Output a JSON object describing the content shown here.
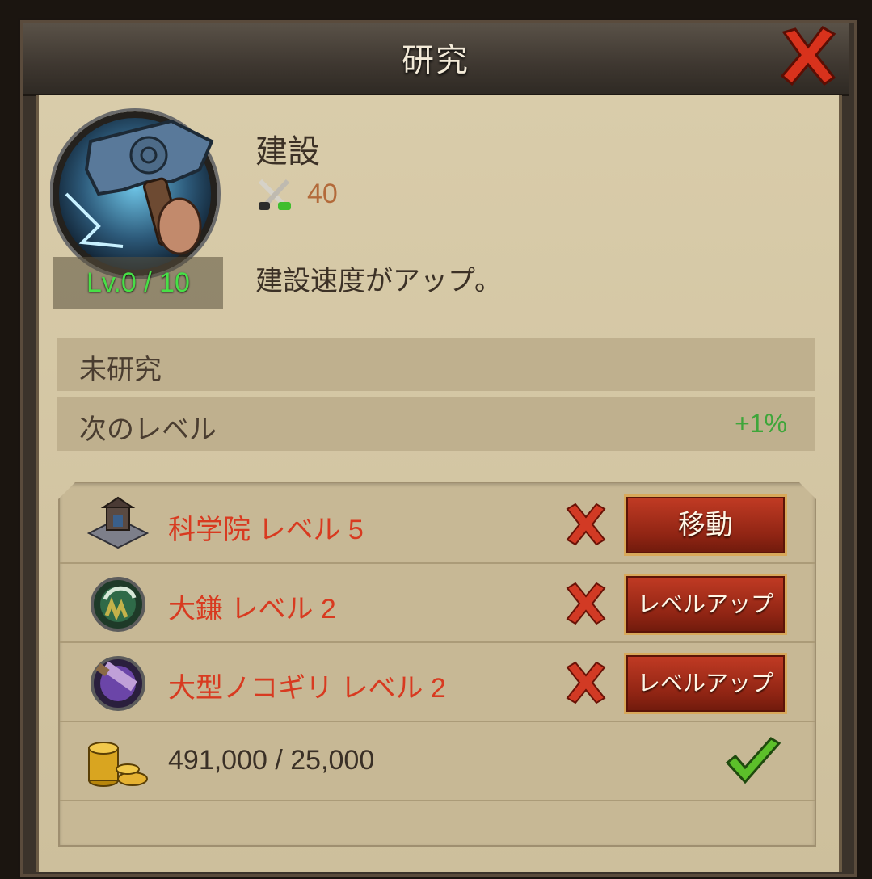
{
  "window": {
    "title": "研究"
  },
  "research": {
    "name": "建設",
    "level_label": "Lv.0 / 10",
    "power_value": "40",
    "description": "建設速度がアップ。",
    "status": "未研究",
    "next_level_label": "次のレベル",
    "next_level_value": "+1%"
  },
  "requirements": [
    {
      "label": "科学院 レベル 5",
      "icon": "academy-building-icon",
      "met": false,
      "action": "移動"
    },
    {
      "label": "大鎌 レベル 2",
      "icon": "scythe-research-icon",
      "met": false,
      "action": "レベルアップ"
    },
    {
      "label": "大型ノコギリ レベル 2",
      "icon": "great-saw-research-icon",
      "met": false,
      "action": "レベルアップ"
    }
  ],
  "cost": {
    "label": "491,000 / 25,000",
    "icon": "gold-coins-icon",
    "met": true
  },
  "colors": {
    "unmet": "#d83a20",
    "met": "#3ea63a",
    "level": "#47e046",
    "button": "#9b2a16"
  }
}
